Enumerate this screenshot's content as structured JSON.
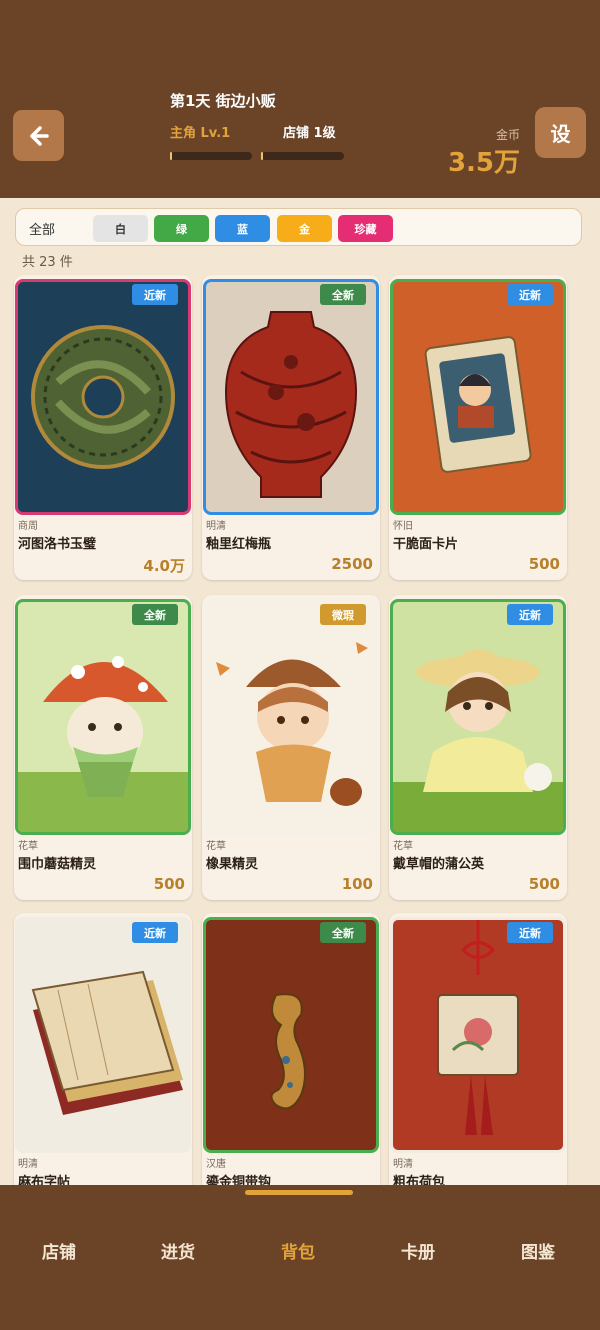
{
  "header": {
    "back_icon": "arrow-left-icon",
    "day_title": "第1天 街边小贩",
    "level_label": "主角 Lv.1",
    "shop_level_label": "店铺 1级",
    "level_progress": 0.02,
    "shop_progress": 0.02,
    "gold_label": "金币",
    "gold_value": "3.5万",
    "settings_label": "设"
  },
  "filters": {
    "all_label": "全部",
    "chips": [
      {
        "label": "白",
        "color": "#e4e4e4",
        "text_color": "#333333"
      },
      {
        "label": "绿",
        "color": "#43a947",
        "text_color": "#ffffff"
      },
      {
        "label": "蓝",
        "color": "#2f8ee4",
        "text_color": "#ffffff"
      },
      {
        "label": "金",
        "color": "#f7ad1a",
        "text_color": "#ffffff"
      },
      {
        "label": "珍藏",
        "color": "#e52d73",
        "text_color": "#ffffff"
      }
    ],
    "count_text": "共 23 件"
  },
  "items": [
    {
      "badge": "近新",
      "badge_color": "#2f8ee4",
      "border_color": "#d63a72",
      "category": "商周",
      "name": "河图洛书玉璧",
      "price": "4.0万",
      "art": "jade-disc"
    },
    {
      "badge": "全新",
      "badge_color": "#3e8a4a",
      "border_color": "#2f8ee4",
      "category": "明清",
      "name": "釉里红梅瓶",
      "price": "2500",
      "art": "vase"
    },
    {
      "badge": "近新",
      "badge_color": "#2f8ee4",
      "border_color": "#4aad4e",
      "category": "怀旧",
      "name": "干脆面卡片",
      "price": "500",
      "art": "card"
    },
    {
      "badge": "全新",
      "badge_color": "#3e8a4a",
      "border_color": "#4aad4e",
      "category": "花草",
      "name": "围巾蘑菇精灵",
      "price": "500",
      "art": "mushroom"
    },
    {
      "badge": "微瑕",
      "badge_color": "#d09a2e",
      "border_color": "#f6f1e8",
      "category": "花草",
      "name": "橡果精灵",
      "price": "100",
      "art": "acorn"
    },
    {
      "badge": "近新",
      "badge_color": "#2f8ee4",
      "border_color": "#4aad4e",
      "category": "花草",
      "name": "戴草帽的蒲公英",
      "price": "500",
      "art": "dandelion"
    },
    {
      "badge": "近新",
      "badge_color": "#2f8ee4",
      "border_color": "#f1ebe0",
      "category": "明清",
      "name": "麻布字帖",
      "price": "",
      "art": "book"
    },
    {
      "badge": "全新",
      "badge_color": "#3e8a4a",
      "border_color": "#4aad4e",
      "category": "汉唐",
      "name": "鎏金铜带钩",
      "price": "",
      "art": "hook"
    },
    {
      "badge": "近新",
      "badge_color": "#2f8ee4",
      "border_color": "#f1ebe0",
      "category": "明清",
      "name": "粗布荷包",
      "price": "",
      "art": "pouch"
    }
  ],
  "nav": [
    {
      "label": "店铺",
      "active": false
    },
    {
      "label": "进货",
      "active": false
    },
    {
      "label": "背包",
      "active": true
    },
    {
      "label": "卡册",
      "active": false
    },
    {
      "label": "图鉴",
      "active": false
    }
  ]
}
